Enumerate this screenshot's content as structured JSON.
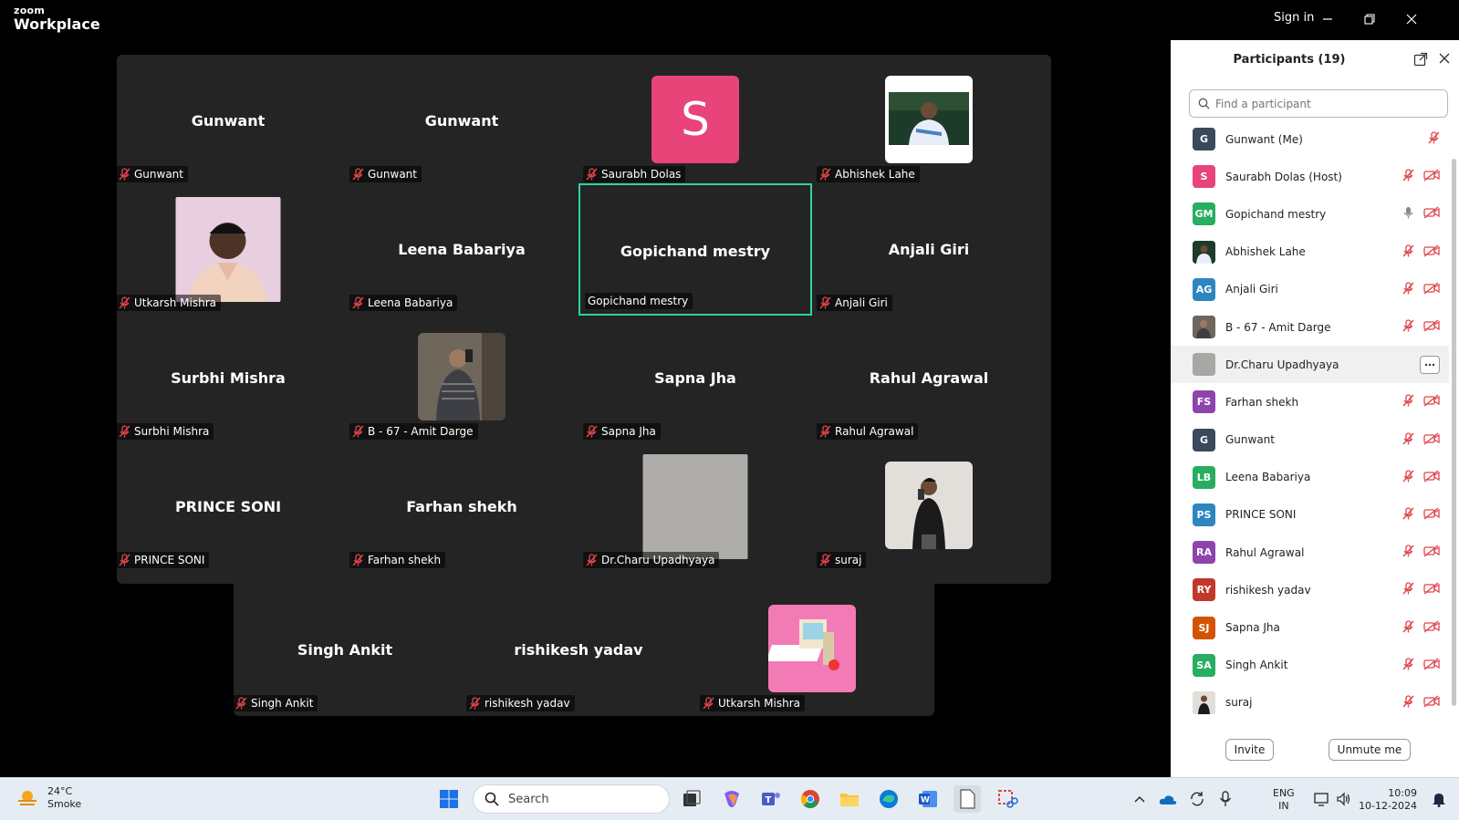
{
  "app": {
    "brand_small": "zoom",
    "brand_big": "Workplace",
    "signin": "Sign in"
  },
  "colors": {
    "accent_green": "#2ed3a0",
    "mute_red": "#e0454a",
    "tile_bg": "#242424"
  },
  "gallery": {
    "tiles": [
      {
        "center": "Gunwant",
        "label": "Gunwant",
        "kind": "name"
      },
      {
        "center": "Gunwant",
        "label": "Gunwant",
        "kind": "name"
      },
      {
        "center": "S",
        "label": "Saurabh Dolas",
        "kind": "letter"
      },
      {
        "center": "",
        "label": "Abhishek Lahe",
        "kind": "photo"
      },
      {
        "center": "",
        "label": "Utkarsh Mishra",
        "kind": "photo"
      },
      {
        "center": "Leena Babariya",
        "label": "Leena Babariya",
        "kind": "name"
      },
      {
        "center": "Gopichand mestry",
        "label": "Gopichand mestry",
        "kind": "name",
        "active": true
      },
      {
        "center": "Anjali Giri",
        "label": "Anjali Giri",
        "kind": "name"
      },
      {
        "center": "Surbhi Mishra",
        "label": "Surbhi Mishra",
        "kind": "name"
      },
      {
        "center": "",
        "label": "B - 67 - Amit Darge",
        "kind": "photo"
      },
      {
        "center": "Sapna Jha",
        "label": "Sapna Jha",
        "kind": "name"
      },
      {
        "center": "Rahul Agrawal",
        "label": "Rahul Agrawal",
        "kind": "name"
      },
      {
        "center": "PRINCE SONI",
        "label": "PRINCE SONI",
        "kind": "name"
      },
      {
        "center": "Farhan shekh",
        "label": "Farhan shekh",
        "kind": "name"
      },
      {
        "center": "",
        "label": "Dr.Charu Upadhyaya",
        "kind": "photo"
      },
      {
        "center": "",
        "label": "suraj",
        "kind": "photo"
      },
      {
        "center": "Singh Ankit",
        "label": "Singh Ankit",
        "kind": "name"
      },
      {
        "center": "rishikesh yadav",
        "label": "rishikesh yadav",
        "kind": "name"
      },
      {
        "center": "",
        "label": "Utkarsh Mishra",
        "kind": "photo"
      }
    ]
  },
  "participants": {
    "title": "Participants (19)",
    "search_placeholder": "Find a participant",
    "items": [
      {
        "initials": "G",
        "name": "Gunwant (Me)",
        "color": "#3a4a5c",
        "video": false,
        "mic": "muted"
      },
      {
        "initials": "S",
        "name": "Saurabh Dolas (Host)",
        "color": "#e8447a",
        "video": true,
        "mic": "muted"
      },
      {
        "initials": "GM",
        "name": "Gopichand mestry",
        "color": "#27ae60",
        "video": true,
        "mic": "on"
      },
      {
        "initials": "",
        "name": "Abhishek Lahe",
        "color": "#2c3e50",
        "video": true,
        "mic": "muted"
      },
      {
        "initials": "AG",
        "name": "Anjali Giri",
        "color": "#2e86c1",
        "video": true,
        "mic": "muted"
      },
      {
        "initials": "",
        "name": "B - 67 - Amit Darge",
        "color": "#6d6d6d",
        "video": true,
        "mic": "muted"
      },
      {
        "initials": "",
        "name": "Dr.Charu Upadhyaya",
        "color": "#9e9e9e",
        "video": false,
        "mic": "more"
      },
      {
        "initials": "FS",
        "name": "Farhan shekh",
        "color": "#8e44ad",
        "video": true,
        "mic": "muted"
      },
      {
        "initials": "G",
        "name": "Gunwant",
        "color": "#3a4a5c",
        "video": true,
        "mic": "muted"
      },
      {
        "initials": "LB",
        "name": "Leena Babariya",
        "color": "#27ae60",
        "video": true,
        "mic": "muted"
      },
      {
        "initials": "PS",
        "name": "PRINCE SONI",
        "color": "#2e86c1",
        "video": true,
        "mic": "muted"
      },
      {
        "initials": "RA",
        "name": "Rahul Agrawal",
        "color": "#8e44ad",
        "video": true,
        "mic": "muted"
      },
      {
        "initials": "RY",
        "name": "rishikesh yadav",
        "color": "#c0392b",
        "video": true,
        "mic": "muted"
      },
      {
        "initials": "SJ",
        "name": "Sapna Jha",
        "color": "#d35400",
        "video": true,
        "mic": "muted"
      },
      {
        "initials": "SA",
        "name": "Singh Ankit",
        "color": "#27ae60",
        "video": true,
        "mic": "muted"
      },
      {
        "initials": "",
        "name": "suraj",
        "color": "#5d4037",
        "video": true,
        "mic": "muted"
      }
    ],
    "invite_label": "Invite",
    "unmute_label": "Unmute me"
  },
  "taskbar": {
    "temp": "24°C",
    "weather": "Smoke",
    "search_label": "Search",
    "lang_top": "ENG",
    "lang_bottom": "IN",
    "time": "10:09",
    "date": "10-12-2024"
  }
}
